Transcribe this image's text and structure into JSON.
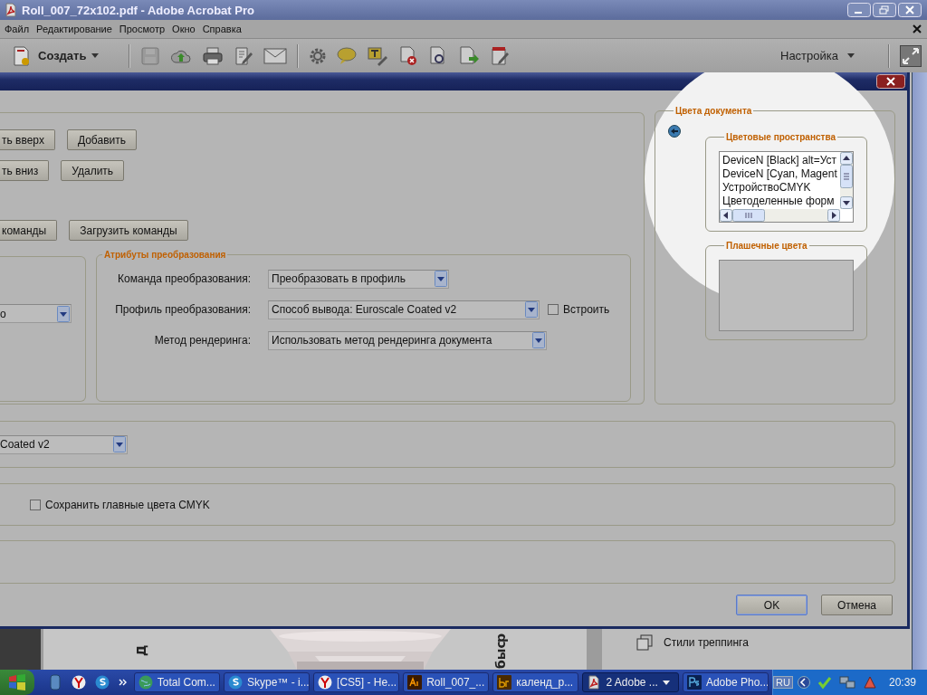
{
  "window": {
    "title": "Roll_007_72x102.pdf - Adobe Acrobat Pro"
  },
  "menu": [
    {
      "label": "Файл"
    },
    {
      "label": "Редактирование"
    },
    {
      "label": "Просмотр"
    },
    {
      "label": "Окно"
    },
    {
      "label": "Справка"
    }
  ],
  "toolbar": {
    "create_label": "Создать",
    "customize_label": "Настройка"
  },
  "document": {
    "texts": [
      {
        "text": "Д"
      },
      {
        "text": "р"
      },
      {
        "text": "быс"
      }
    ]
  },
  "side_panel": {
    "items": [
      {
        "label": "Стили треппинга"
      }
    ]
  },
  "dialog": {
    "command_buttons": [
      {
        "labels": [
          "ть вверх",
          "Добавить"
        ]
      },
      {
        "labels": [
          "ть вниз",
          "Удалить"
        ]
      },
      {
        "labels": [
          "команды",
          "Загрузить команды"
        ]
      }
    ],
    "left_dropdown": {
      "value": "о"
    },
    "conversion_attributes": {
      "title": "Атрибуты преобразования",
      "rows": [
        {
          "label": "Команда преобразования:",
          "value": "Преобразовать в профиль"
        },
        {
          "label": "Профиль преобразования:",
          "value": "Способ вывода: Euroscale Coated v2",
          "embed": {
            "label": "Встроить",
            "checked": false
          }
        },
        {
          "label": "Метод рендеринга:",
          "value": "Использовать метод рендеринга документа"
        }
      ]
    },
    "document_colors": {
      "title": "Цвета документа",
      "color_spaces": {
        "title": "Цветовые пространства",
        "items": [
          "DeviceN [Black] alt=Уст",
          "DeviceN [Cyan, Magent",
          "УстройствоCMYK",
          "Цветоделенные форм"
        ]
      },
      "spot_colors": {
        "title": "Плашечные цвета"
      }
    },
    "profile_dropdown": {
      "value": "Coated v2"
    },
    "preserve_cmyk": {
      "label": "Сохранить главные цвета CMYK",
      "checked": false
    },
    "buttons": [
      {
        "label": "OK",
        "default": true
      },
      {
        "label": "Отмена",
        "default": false
      }
    ]
  },
  "taskbar": {
    "tasks": [
      {
        "label": "Total Com...",
        "selected": false
      },
      {
        "label": "Skype™ - i...",
        "selected": false
      },
      {
        "label": "[CS5] - Не...",
        "selected": false
      },
      {
        "label": "Roll_007_...",
        "selected": false
      },
      {
        "label": "календ_р...",
        "selected": false
      },
      {
        "label": "2 Adobe ...",
        "selected": true
      },
      {
        "label": "Adobe Pho...",
        "selected": false
      }
    ],
    "language": "RU",
    "clock": "20:39"
  }
}
